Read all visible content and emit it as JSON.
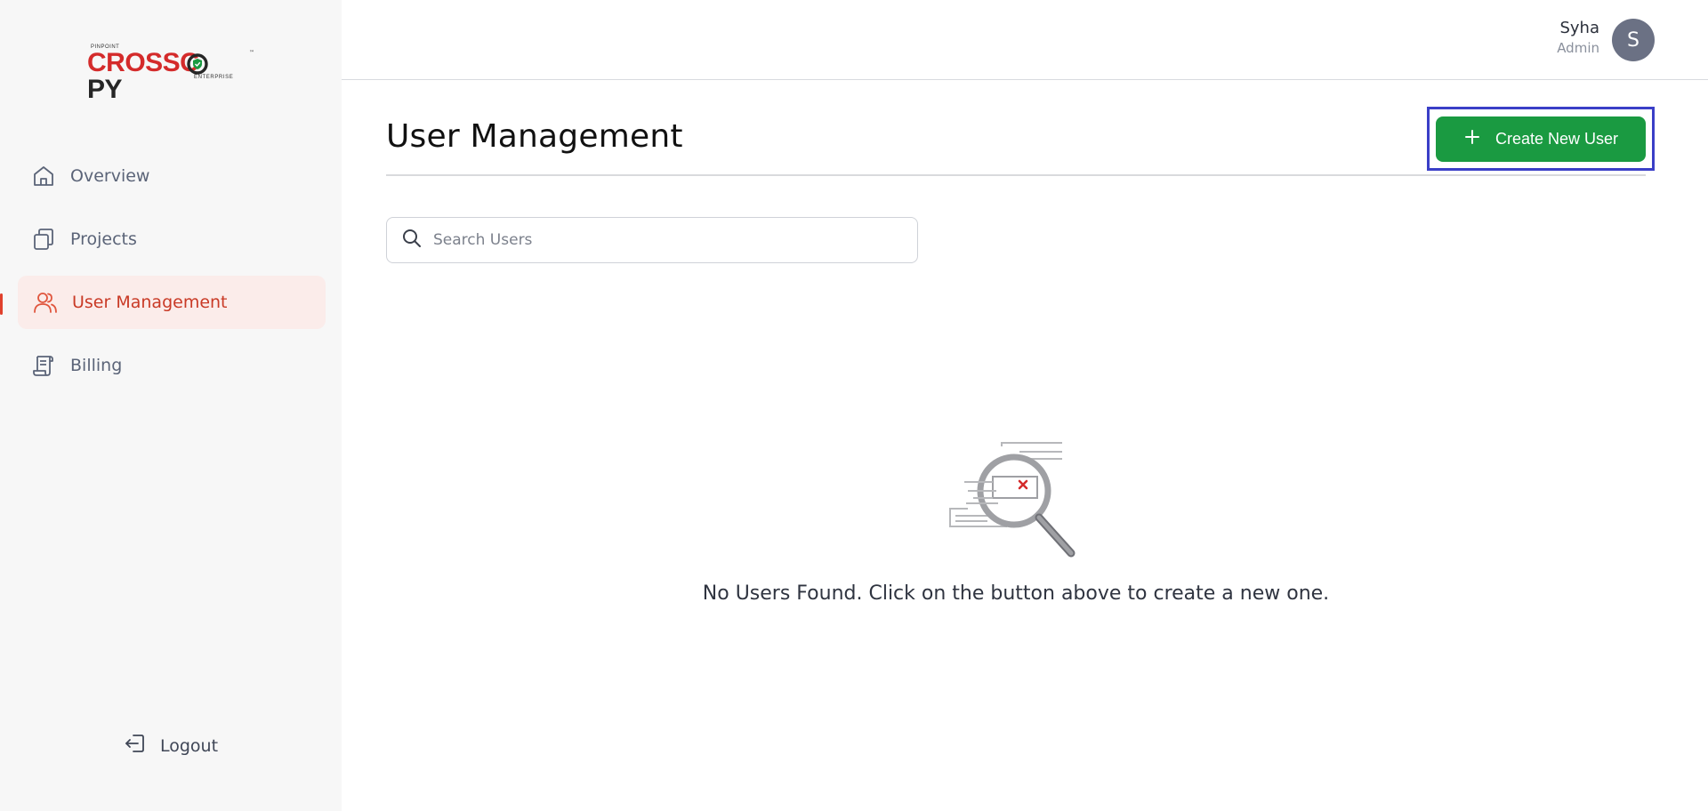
{
  "logo": {
    "top_text": "PINPOINT",
    "word_red": "CROSSC",
    "word_dark": "PY",
    "bottom_text": "ENTERPRISE",
    "trademark": "™"
  },
  "sidebar": {
    "items": [
      {
        "label": "Overview",
        "icon": "home-icon",
        "active": false
      },
      {
        "label": "Projects",
        "icon": "projects-icon",
        "active": false
      },
      {
        "label": "User Management",
        "icon": "users-icon",
        "active": true
      },
      {
        "label": "Billing",
        "icon": "billing-icon",
        "active": false
      }
    ],
    "logout_label": "Logout"
  },
  "header": {
    "user_name": "Syha",
    "user_role": "Admin",
    "avatar_initial": "S"
  },
  "main": {
    "title": "User Management",
    "create_button_label": "Create New User",
    "search_placeholder": "Search Users",
    "empty_message": "No Users Found. Click on the button above to create a new one."
  },
  "colors": {
    "accent_red": "#c93a26",
    "active_bg": "#fbecea",
    "primary_green": "#1a9a41",
    "focus_outline": "#3a3fc7",
    "avatar_bg": "#6b7184"
  }
}
